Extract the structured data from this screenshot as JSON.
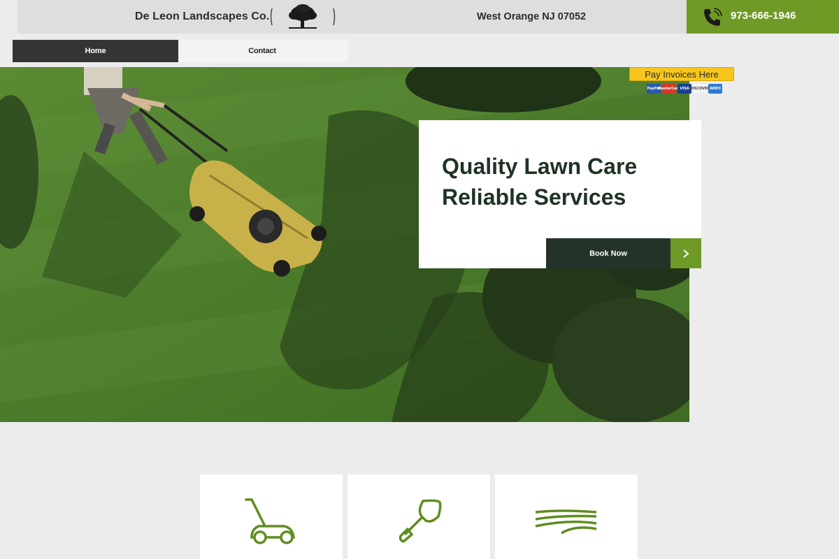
{
  "header": {
    "brand_name": "De Leon Landscapes Co.",
    "location": "West Orange NJ 07052",
    "phone": "973-666-1946"
  },
  "nav": {
    "items": [
      {
        "label": "Home",
        "active": true
      },
      {
        "label": "Contact",
        "active": false
      }
    ]
  },
  "payments": {
    "pay_label": "Pay Invoices Here",
    "cards": [
      "PayPal",
      "MasterCard",
      "VISA",
      "DISCOVER",
      "AMEX"
    ]
  },
  "hero": {
    "title_line1": "Quality Lawn Care",
    "title_line2": "Reliable Services",
    "cta_label": "Book Now"
  },
  "services": [
    {
      "icon": "lawn-mower-icon"
    },
    {
      "icon": "trowel-icon"
    },
    {
      "icon": "field-icon"
    }
  ],
  "colors": {
    "accent_green": "#6f9a25",
    "dark_green": "#24332a",
    "heading": "#1f3325",
    "pay_yellow": "#f6c61c"
  }
}
